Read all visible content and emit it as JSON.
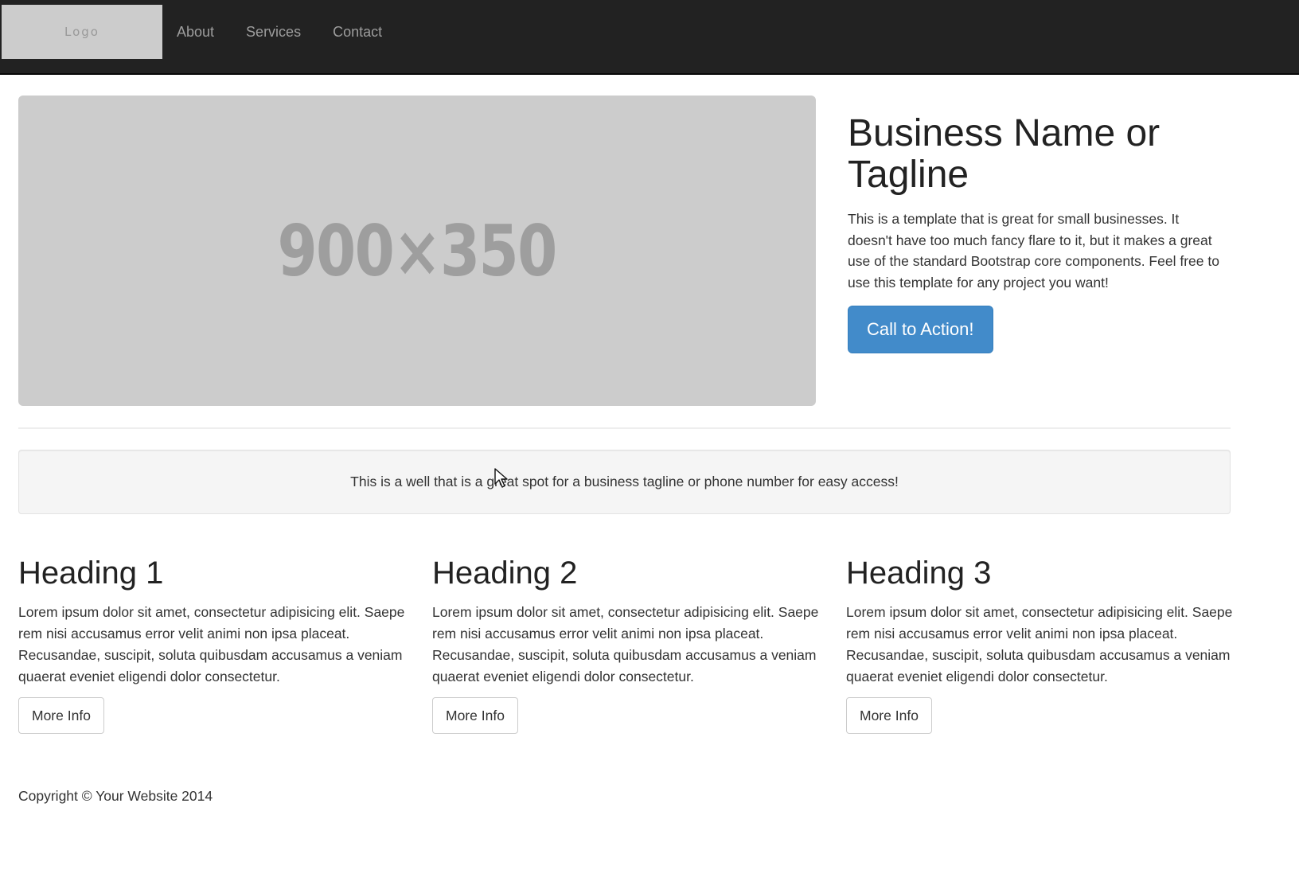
{
  "navbar": {
    "logo_text": "Logo",
    "links": [
      {
        "label": "About"
      },
      {
        "label": "Services"
      },
      {
        "label": "Contact"
      }
    ]
  },
  "hero": {
    "image_label": "900×350",
    "title": "Business Name or Tagline",
    "description": "This is a template that is great for small businesses. It doesn't have too much fancy flare to it, but it makes a great use of the standard Bootstrap core components. Feel free to use this template for any project you want!",
    "cta_label": "Call to Action!"
  },
  "well": {
    "text": "This is a well that is a great spot for a business tagline or phone number for easy access!"
  },
  "features": [
    {
      "heading": "Heading 1",
      "text": "Lorem ipsum dolor sit amet, consectetur adipisicing elit. Saepe rem nisi accusamus error velit animi non ipsa placeat. Recusandae, suscipit, soluta quibusdam accusamus a veniam quaerat eveniet eligendi dolor consectetur.",
      "button_label": "More Info"
    },
    {
      "heading": "Heading 2",
      "text": "Lorem ipsum dolor sit amet, consectetur adipisicing elit. Saepe rem nisi accusamus error velit animi non ipsa placeat. Recusandae, suscipit, soluta quibusdam accusamus a veniam quaerat eveniet eligendi dolor consectetur.",
      "button_label": "More Info"
    },
    {
      "heading": "Heading 3",
      "text": "Lorem ipsum dolor sit amet, consectetur adipisicing elit. Saepe rem nisi accusamus error velit animi non ipsa placeat. Recusandae, suscipit, soluta quibusdam accusamus a veniam quaerat eveniet eligendi dolor consectetur.",
      "button_label": "More Info"
    }
  ],
  "footer": {
    "copyright": "Copyright © Your Website 2014"
  },
  "colors": {
    "navbar_bg": "#222222",
    "primary": "#428bca",
    "placeholder_bg": "#cccccc",
    "well_bg": "#f5f5f5"
  },
  "icons": {
    "cursor": "mouse-pointer-icon"
  }
}
